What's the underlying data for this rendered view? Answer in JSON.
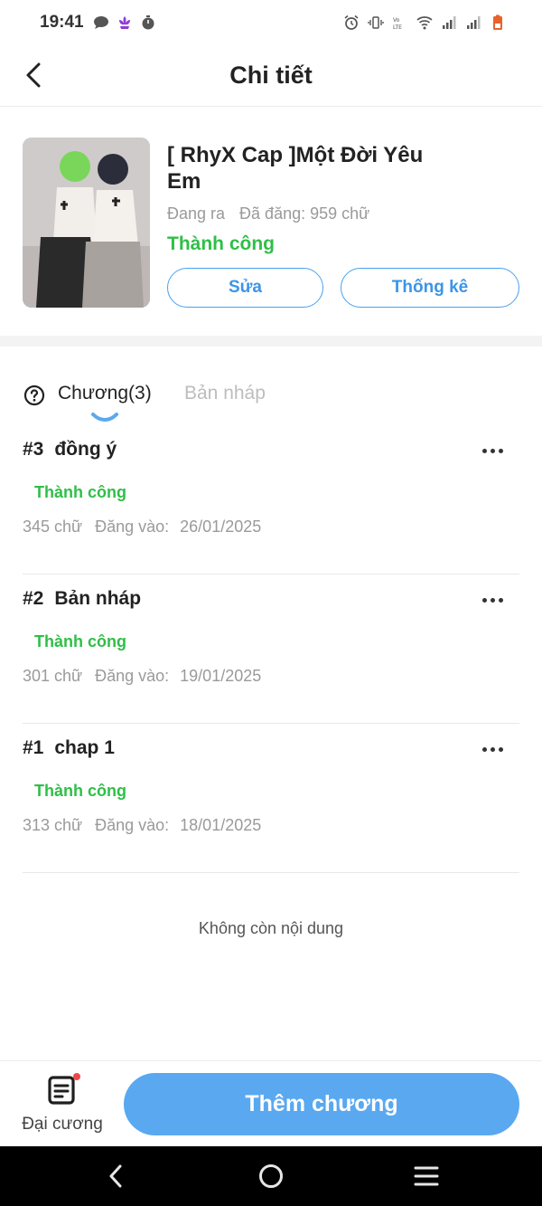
{
  "status_bar": {
    "time": "19:41",
    "icons_left": [
      "chat-icon",
      "lotus-icon",
      "timer-icon"
    ],
    "icons_right": [
      "alarm-icon",
      "vibrate-icon",
      "volte-icon",
      "wifi-icon",
      "signal-icon",
      "signal-icon-2",
      "battery-icon"
    ]
  },
  "header": {
    "title": "Chi tiết"
  },
  "book": {
    "title": "[ RhyX Cap ]Một Đời Yêu Em",
    "publish_state": "Đang ra",
    "word_count": "Đã đăng: 959 chữ",
    "status": "Thành công",
    "edit_label": "Sửa",
    "stats_label": "Thống kê"
  },
  "tabs": {
    "chapters_label": "Chương(3)",
    "drafts_label": "Bản nháp"
  },
  "chapters": [
    {
      "number": "#3",
      "title": "đồng ý",
      "status": "Thành công",
      "words": "345 chữ",
      "posted_label": "Đăng vào:",
      "date": "26/01/2025"
    },
    {
      "number": "#2",
      "title": "Bản nháp",
      "status": "Thành công",
      "words": "301 chữ",
      "posted_label": "Đăng vào:",
      "date": "19/01/2025"
    },
    {
      "number": "#1",
      "title": "chap 1",
      "status": "Thành công",
      "words": "313 chữ",
      "posted_label": "Đăng vào:",
      "date": "18/01/2025"
    }
  ],
  "end_text": "Không còn nội dung",
  "bottom": {
    "outline_label": "Đại cương",
    "add_chapter_label": "Thêm chương"
  },
  "colors": {
    "accent": "#5aa8f0",
    "success": "#2fbf47",
    "muted": "#9a9a9a"
  }
}
